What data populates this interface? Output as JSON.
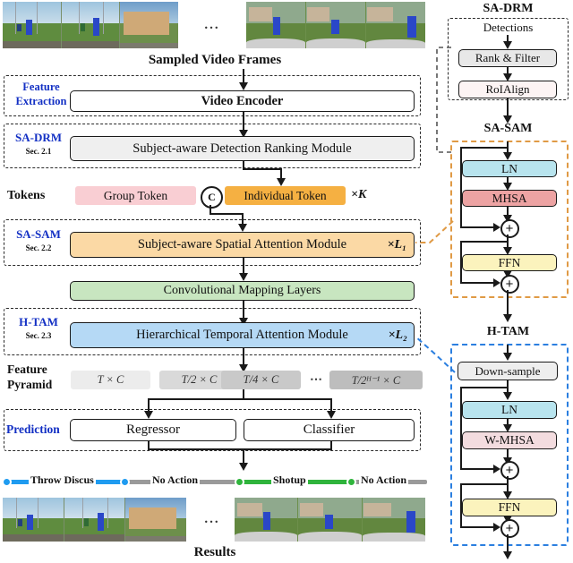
{
  "top_strip": {
    "ellipsis": "..."
  },
  "main_title": "Sampled Video Frames",
  "stages": {
    "feature_extraction": {
      "label_line1": "Feature",
      "label_line2": "Extraction",
      "box": "Video Encoder"
    },
    "sa_drm": {
      "label": "SA-DRM",
      "section": "Sec. 2.1",
      "box": "Subject-aware Detection Ranking Module"
    },
    "tokens": {
      "label": "Tokens",
      "group_token": "Group Token",
      "concat_symbol": "C",
      "individual_token": "Individual Token",
      "multiplier": "×K"
    },
    "sa_sam": {
      "label": "SA-SAM",
      "section": "Sec. 2.2",
      "box": "Subject-aware Spatial Attention Module",
      "multiplier": "×L₁"
    },
    "conv": {
      "box": "Convolutional Mapping Layers"
    },
    "h_tam": {
      "label": "H-TAM",
      "section": "Sec. 2.3",
      "box": "Hierarchical  Temporal Attention Module",
      "multiplier": "×L₂"
    },
    "feature_pyramid": {
      "label_line1": "Feature",
      "label_line2": "Pyramid",
      "levels": [
        "T × C",
        "T/2 × C",
        "T/4 × C",
        "T/2ᴴ⁻¹ × C"
      ],
      "ellipsis": "⋯"
    },
    "prediction": {
      "label": "Prediction",
      "regressor": "Regressor",
      "classifier": "Classifier"
    }
  },
  "timeline": {
    "segments": [
      {
        "label": "Throw Discus",
        "color": "#1f9bf0"
      },
      {
        "label": "No Action",
        "color": "#9a9a9a"
      },
      {
        "label": "Shotup",
        "color": "#2fb43c"
      },
      {
        "label": "No Action",
        "color": "#9a9a9a"
      }
    ]
  },
  "bottom_strip": {
    "ellipsis": "...",
    "caption": "Results"
  },
  "right_panels": {
    "sa_drm": {
      "title": "SA-DRM",
      "input_label": "Detections",
      "blocks": [
        {
          "label": "Rank & Filter",
          "color": "#e8e8e8"
        },
        {
          "label": "RoIAlign",
          "color": "#fdf4f4"
        }
      ]
    },
    "sa_sam": {
      "title": "SA-SAM",
      "blocks": [
        {
          "label": "LN",
          "color": "#b8e4ee"
        },
        {
          "label": "MHSA",
          "color": "#eda3a3"
        },
        {
          "label": "FFN",
          "color": "#fbf3bd"
        }
      ],
      "add_symbol": "+"
    },
    "h_tam": {
      "title": "H-TAM",
      "blocks": [
        {
          "label": "Down-sample",
          "color": "#eeeeee"
        },
        {
          "label": "LN",
          "color": "#b8e4ee"
        },
        {
          "label": "W-MHSA",
          "color": "#f3dcdf"
        },
        {
          "label": "FFN",
          "color": "#fbf3bd"
        }
      ],
      "add_symbol": "+"
    }
  },
  "colors": {
    "accent_blue_label": "#1330c4",
    "drm_box": "#efefef",
    "sam_box": "#fbd9a5",
    "conv_box": "#c8e6c0",
    "tam_box": "#b5d9f5",
    "group_token": "#f9ced3",
    "individual_token": "#f5b042",
    "pyramid": [
      "#ececec",
      "#d9d9d9",
      "#c9c9c9",
      "#bdbdbd"
    ]
  }
}
